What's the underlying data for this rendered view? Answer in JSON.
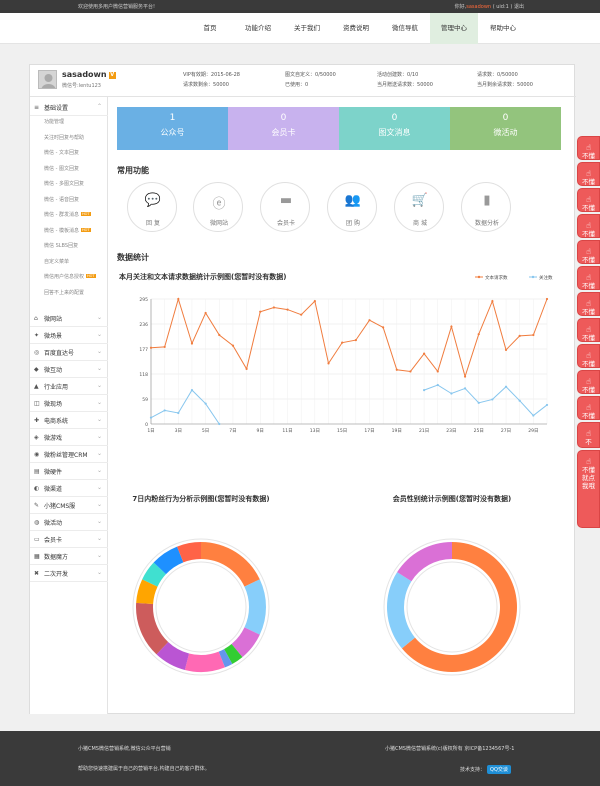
{
  "topbar": {
    "welcome": "欢迎使用多用户微信营销服务平台!",
    "greeting": "你好,",
    "username": "sasadown",
    "uid": "( uid:1 )",
    "logout": "退出"
  },
  "nav": {
    "items": [
      {
        "label": "首页"
      },
      {
        "label": "功能介绍"
      },
      {
        "label": "关于我们"
      },
      {
        "label": "资费说明"
      },
      {
        "label": "微信导航"
      },
      {
        "label": "管理中心",
        "active": true
      },
      {
        "label": "帮助中心"
      }
    ]
  },
  "user": {
    "name": "sasadown",
    "vip_badge": "V",
    "wechat_id": "微信号:lentu123"
  },
  "stats": [
    {
      "label": "VIP有效期：",
      "value": "2015-06-28"
    },
    {
      "label": "请求数剩余：",
      "value": "50000"
    },
    {
      "label": "图文自定义：",
      "value": "0/50000"
    },
    {
      "label": "已使用：",
      "value": "0"
    },
    {
      "label": "活动创建数：",
      "value": "0/10"
    },
    {
      "label": "当月赠送请求数：",
      "value": "50000"
    },
    {
      "label": "请求数：",
      "value": "0/50000"
    },
    {
      "label": "当月剩余请求数：",
      "value": "50000"
    }
  ],
  "sidebar": {
    "groups": [
      {
        "icon": "≡",
        "label": "基础设置",
        "open": true
      },
      {
        "icon": "⌂",
        "label": "微网站"
      },
      {
        "icon": "✦",
        "label": "微场景"
      },
      {
        "icon": "◎",
        "label": "百度直达号"
      },
      {
        "icon": "◆",
        "label": "微互动"
      },
      {
        "icon": "▲",
        "label": "行业应用"
      },
      {
        "icon": "◫",
        "label": "微现场"
      },
      {
        "icon": "✚",
        "label": "电商系统"
      },
      {
        "icon": "◈",
        "label": "微游戏"
      },
      {
        "icon": "◉",
        "label": "微粉丝管理CRM"
      },
      {
        "icon": "▤",
        "label": "微硬件"
      },
      {
        "icon": "◐",
        "label": "微渠道"
      },
      {
        "icon": "✎",
        "label": "小猪CMS服"
      },
      {
        "icon": "◍",
        "label": "微活动"
      },
      {
        "icon": "▭",
        "label": "会员卡"
      },
      {
        "icon": "▦",
        "label": "数据魔方"
      },
      {
        "icon": "✖",
        "label": "二次开发"
      }
    ],
    "sub_items": [
      {
        "label": "功能管理"
      },
      {
        "label": "关注时回复与帮助"
      },
      {
        "label": "微信 - 文本回复"
      },
      {
        "label": "微信 - 图文回复"
      },
      {
        "label": "微信 - 多图文回复"
      },
      {
        "label": "微信 - 语音回复"
      },
      {
        "label": "微信 - 群发消息",
        "hot": "HOT"
      },
      {
        "label": "微信 - 模板消息",
        "hot": "HOT"
      },
      {
        "label": "微信 SLBS回复"
      },
      {
        "label": "自定义菜单"
      },
      {
        "label": "微信用户信息授权",
        "hot": "HOT"
      },
      {
        "label": "回答不上来的配置"
      }
    ]
  },
  "tiles": [
    {
      "num": "1",
      "label": "公众号",
      "color": "#6ab0e4"
    },
    {
      "num": "0",
      "label": "会员卡",
      "color": "#c8b2ee"
    },
    {
      "num": "0",
      "label": "图文消息",
      "color": "#7dd3ca"
    },
    {
      "num": "0",
      "label": "微活动",
      "color": "#93c47d"
    }
  ],
  "sections": {
    "common": "常用功能",
    "stats": "数据统计"
  },
  "functions": [
    {
      "label": "回 复",
      "icon": "💬"
    },
    {
      "label": "微网站",
      "icon": "ⓔ"
    },
    {
      "label": "会员卡",
      "icon": "▬"
    },
    {
      "label": "团 购",
      "icon": "👥"
    },
    {
      "label": "商 城",
      "icon": "🛒"
    },
    {
      "label": "数据分析",
      "icon": "▮"
    }
  ],
  "chart_data": [
    {
      "type": "line",
      "title": "本月关注和文本请求数据统计示例图(您暂时没有数据)",
      "x": [
        "1日",
        "2日",
        "3日",
        "4日",
        "5日",
        "6日",
        "7日",
        "8日",
        "9日",
        "10日",
        "11日",
        "12日",
        "13日",
        "14日",
        "15日",
        "16日",
        "17日",
        "18日",
        "19日",
        "20日",
        "21日",
        "22日",
        "23日",
        "24日",
        "25日",
        "26日",
        "27日",
        "28日",
        "29日",
        "30日"
      ],
      "xticks": [
        "1日",
        "3日",
        "5日",
        "7日",
        "9日",
        "11日",
        "13日",
        "15日",
        "17日",
        "19日",
        "21日",
        "23日",
        "25日",
        "27日",
        "29日"
      ],
      "yticks": [
        0,
        59,
        118,
        177,
        236,
        295
      ],
      "ylim": [
        0,
        295
      ],
      "series": [
        {
          "name": "文本请求数",
          "color": "#f07c3e",
          "values": [
            180,
            182,
            295,
            190,
            262,
            210,
            185,
            130,
            265,
            275,
            270,
            258,
            290,
            143,
            192,
            198,
            245,
            228,
            128,
            124,
            166,
            124,
            230,
            112,
            212,
            290,
            175,
            208,
            210,
            295,
            118
          ]
        },
        {
          "name": "关注数",
          "color": "#87c6ee",
          "values": [
            15,
            32,
            26,
            80,
            48,
            0,
            null,
            null,
            null,
            null,
            null,
            null,
            null,
            null,
            null,
            null,
            null,
            null,
            null,
            null,
            80,
            92,
            72,
            84,
            50,
            58,
            88,
            55,
            20,
            45,
            17
          ]
        }
      ],
      "legend": "top-right"
    },
    {
      "type": "pie",
      "title": "7日内粉丝行为分析示例图(您暂时没有数据)",
      "values": [
        18,
        14,
        7,
        3,
        2,
        10,
        8,
        14,
        6,
        5,
        7,
        6
      ],
      "colors": [
        "#ff8040",
        "#87cefa",
        "#da70d6",
        "#32cd32",
        "#6495ed",
        "#ff69b4",
        "#ba55d3",
        "#cd5c5c",
        "#ffa500",
        "#40e0d0",
        "#1e90ff",
        "#ff6347"
      ]
    },
    {
      "type": "pie",
      "title": "会员性别统计示例图(您暂时没有数据)",
      "values": [
        64,
        20,
        16
      ],
      "colors": [
        "#ff8040",
        "#87cefa",
        "#da70d6"
      ]
    }
  ],
  "footer": {
    "left1": "小猪CMS微信营销系统,微信公众平台营销",
    "left2": "帮助您快速搭建属于自己的营销平台,构建自己的客户群体。",
    "right1": "小猪CMS微信营销系统(c)版权所有 京ICP备1234567号-1",
    "support": "技术支持：",
    "qq": "QQ交谈"
  },
  "side_tabs": [
    {
      "label": "不懂"
    },
    {
      "label": "不懂"
    },
    {
      "label": "不懂"
    },
    {
      "label": "不懂"
    },
    {
      "label": "不懂"
    },
    {
      "label": "不懂"
    },
    {
      "label": "不懂"
    },
    {
      "label": "不懂"
    },
    {
      "label": "不懂"
    },
    {
      "label": "不懂"
    },
    {
      "label": "不懂"
    },
    {
      "label": "不"
    },
    {
      "label": "不懂就点我哦"
    }
  ]
}
